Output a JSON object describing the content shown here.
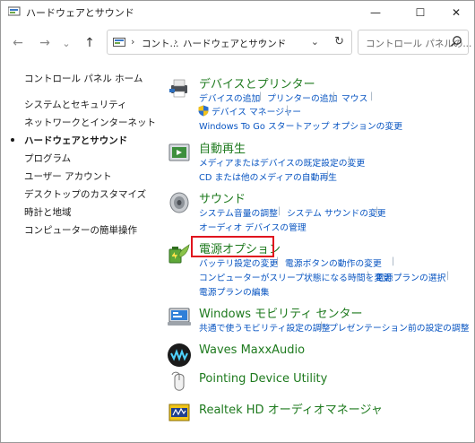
{
  "window": {
    "title": "ハードウェアとサウンド",
    "minimize": "—",
    "maximize": "☐",
    "close": "✕"
  },
  "nav": {
    "back": "←",
    "forward": "→",
    "dropdown_arrow": "⌄",
    "up": "↑"
  },
  "address": {
    "parts": [
      "コント...",
      "ハードウェアとサウンド"
    ],
    "separator": "›",
    "dropdown": "⌄",
    "refresh": "↻"
  },
  "search": {
    "placeholder": "コントロール パネルの..."
  },
  "left_nav": {
    "items": [
      {
        "label": "コントロール パネル ホーム"
      },
      {
        "label": "システムとセキュリティ"
      },
      {
        "label": "ネットワークとインターネット"
      },
      {
        "label": "ハードウェアとサウンド",
        "current": true
      },
      {
        "label": "プログラム"
      },
      {
        "label": "ユーザー アカウント"
      },
      {
        "label": "デスクトップのカスタマイズ"
      },
      {
        "label": "時計と地域"
      },
      {
        "label": "コンピューターの簡単操作"
      }
    ]
  },
  "categories": {
    "devices": {
      "title": "デバイスとプリンター",
      "links": [
        "デバイスの追加",
        "プリンターの追加",
        "マウス",
        "デバイス マネージャー",
        "Windows To Go スタートアップ オプションの変更"
      ]
    },
    "autoplay": {
      "title": "自動再生",
      "links": [
        "メディアまたはデバイスの既定設定の変更",
        "CD または他のメディアの自動再生"
      ]
    },
    "sound": {
      "title": "サウンド",
      "links": [
        "システム音量の調整",
        "システム サウンドの変更",
        "オーディオ デバイスの管理"
      ]
    },
    "power": {
      "title": "電源オプション",
      "links": [
        "バッテリ設定の変更",
        "電源ボタンの動作の変更",
        "コンピューターがスリープ状態になる時間を変更",
        "電源プランの選択",
        "電源プランの編集"
      ]
    },
    "mobility": {
      "title": "Windows モビリティ センター",
      "links": [
        "共通で使うモビリティ設定の調整",
        "プレゼンテーション前の設定の調整"
      ]
    },
    "waves": {
      "title": "Waves MaxxAudio"
    },
    "pointing": {
      "title": "Pointing Device Utility"
    },
    "realtek": {
      "title": "Realtek HD オーディオマネージャ"
    }
  },
  "colors": {
    "category_title": "#1e7a1e",
    "link": "#0a56c2",
    "highlight": "#e0141e"
  }
}
